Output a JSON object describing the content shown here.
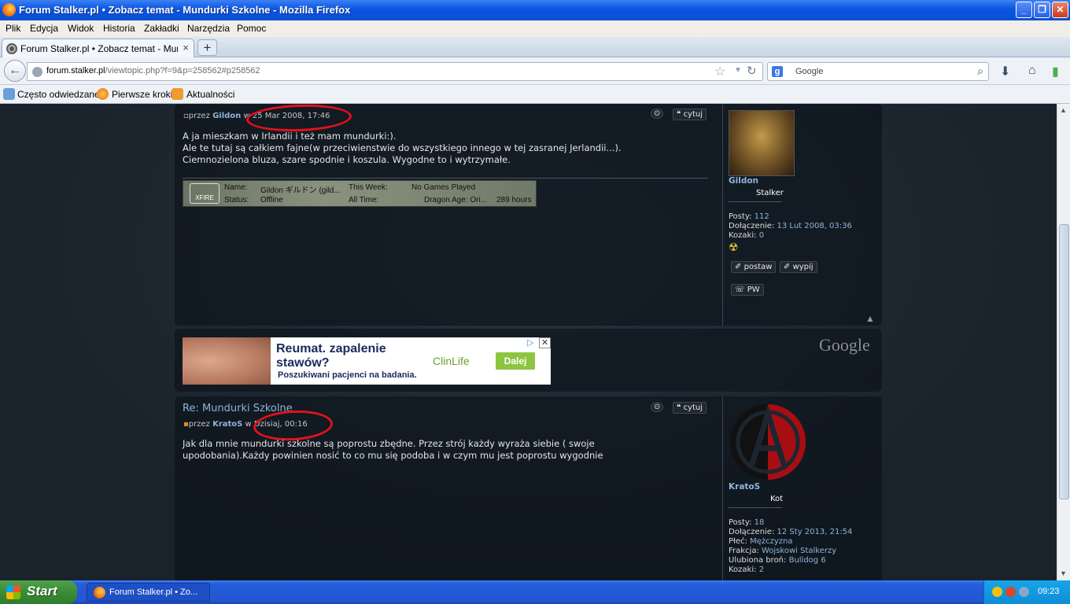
{
  "window": {
    "title": "Forum Stalker.pl • Zobacz temat - Mundurki Szkolne - Mozilla Firefox"
  },
  "menu": [
    "Plik",
    "Edycja",
    "Widok",
    "Historia",
    "Zakładki",
    "Narzędzia",
    "Pomoc"
  ],
  "tab": {
    "label": "Forum Stalker.pl • Zobacz temat - Mundurki ...",
    "new_tab": "+"
  },
  "nav": {
    "url_domain": "forum.stalker.pl",
    "url_path": "/viewtopic.php?f=9&p=258562#p258562",
    "search_placeholder": "Google"
  },
  "bookmarks": [
    "Często odwiedzane",
    "Pierwsze kroki",
    "Aktualności"
  ],
  "post1": {
    "prefix": "przez",
    "author": "Gildon",
    "in": "w",
    "date": "25 Mar 2008, 17:46",
    "quote_btn": "cytuj",
    "body": [
      "A ja mieszkam w Irlandii i też mam mundurki:).",
      "Ale te tutaj są całkiem fajne(w przeciwienstwie do wszystkiego innego w tej zasranej Jerlandii...).",
      "Ciemnozielona bluza, szare spodnie i koszula. Wygodne to i wytrzymałe."
    ],
    "xfire": {
      "logo": "XFIRE",
      "name_label": "Name:",
      "name_value": "Gildon ギルドン (gild...",
      "status_label": "Status:",
      "status_value": "Offline",
      "week_label": "This Week:",
      "week_value": "No Games Played",
      "alltime_label": "All Time:",
      "alltime_value": "Dragon Age: Ori...",
      "alltime_hours": "289 hours"
    },
    "profile": {
      "username": "Gildon",
      "rank": "Stalker",
      "posts_label": "Posty:",
      "posts": "112",
      "joined_label": "Dołączenie:",
      "joined": "13 Lut 2008, 03:36",
      "kozaki_label": "Kozaki:",
      "kozaki": "0",
      "btn_postaw": "postaw",
      "btn_wypij": "wypij",
      "btn_pw": "PW"
    }
  },
  "ad": {
    "headline": "Reumat. zapalenie stawów?",
    "sub": "Poszukiwani pacjenci na badania.",
    "brand": "ClinLife",
    "cta": "Dalej",
    "google": "Google"
  },
  "post2": {
    "title": "Re: Mundurki Szkolne",
    "prefix": "przez",
    "author": "KratoS",
    "in": "w",
    "date": "Dzisiaj, 00:16",
    "quote_btn": "cytuj",
    "body": [
      "Jak dla mnie mundurki szkolne są poprostu zbędne. Przez strój każdy wyraża siebie ( swoje",
      "upodobania).Każdy powinien nosić to co mu się podoba i w czym mu jest poprostu wygodnie"
    ],
    "profile": {
      "username": "KratoS",
      "rank": "Kot",
      "posts_label": "Posty:",
      "posts": "18",
      "joined_label": "Dołączenie:",
      "joined": "12 Sty 2013, 21:54",
      "gender_label": "Płeć:",
      "gender": "Mężczyzna",
      "faction_label": "Frakcja:",
      "faction": "Wojskowi Stalkerzy",
      "weapon_label": "Ulubiona broń:",
      "weapon": "Bulldog 6",
      "kozaki_label": "Kozaki:",
      "kozaki": "2"
    }
  },
  "taskbar": {
    "start": "Start",
    "task": "Forum Stalker.pl • Zo...",
    "clock": "09:23"
  },
  "colors": {
    "accent_link": "#8fb4d9",
    "annotation_red": "#e3111b"
  }
}
